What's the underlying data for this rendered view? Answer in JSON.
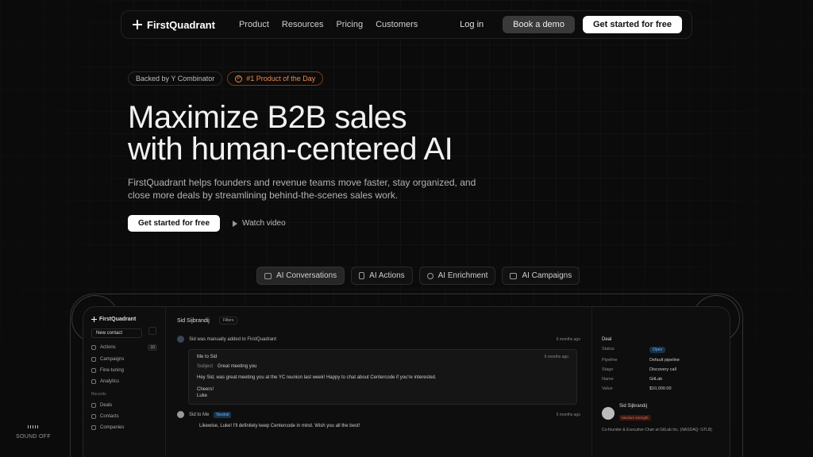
{
  "nav": {
    "brand": "FirstQuadrant",
    "links": [
      "Product",
      "Resources",
      "Pricing",
      "Customers"
    ],
    "login": "Log in",
    "demo": "Book a demo",
    "start": "Get started for free"
  },
  "hero": {
    "badge_yc": "Backed by Y Combinator",
    "badge_ph": "#1 Product of the Day",
    "headline_1": "Maximize B2B sales",
    "headline_2": "with human-centered AI",
    "subtext": "FirstQuadrant helps founders and revenue teams move faster, stay organized, and close more deals by streamlining behind-the-scenes sales work.",
    "cta_primary": "Get started for free",
    "cta_video": "Watch video"
  },
  "tabs": [
    {
      "label": "AI Conversations",
      "icon": "chat-icon",
      "active": true
    },
    {
      "label": "AI Actions",
      "icon": "document-icon",
      "active": false
    },
    {
      "label": "AI Enrichment",
      "icon": "search-icon",
      "active": false
    },
    {
      "label": "AI Campaigns",
      "icon": "mail-icon",
      "active": false
    }
  ],
  "app": {
    "brand": "FirstQuadrant",
    "new_contact": "New contact",
    "sidebar": [
      {
        "label": "Actions",
        "count": "10"
      },
      {
        "label": "Campaigns"
      },
      {
        "label": "Fine-tuning"
      },
      {
        "label": "Analytics"
      }
    ],
    "records_label": "Records",
    "records": [
      "Deals",
      "Contacts",
      "Companies"
    ],
    "contact_name": "Sid Sijbrandij",
    "filters": "Filters",
    "feed_event": "Sid was manually added to FirstQuadrant",
    "feed_event_time": "6 months ago",
    "email": {
      "from_to": "Me to Sid",
      "time": "6 months ago",
      "subject_label": "Subject",
      "subject": "Great meeting you",
      "body": "Hey Sid, was great meeting you at the YC reunion last week! Happy to chat about Centercode if you're interested.",
      "signoff_1": "Cheers!",
      "signoff_2": "Luke"
    },
    "reply": {
      "from_to": "Sid to Me",
      "tag": "Neutral",
      "time": "6 months ago",
      "body": "Likewise, Luke! I'll definitely keep Centercode in mind. Wish you all the best!"
    },
    "deal": {
      "title": "Deal",
      "rows": [
        {
          "k": "Status",
          "v": "Open"
        },
        {
          "k": "Pipeline",
          "v": "Default pipeline"
        },
        {
          "k": "Stage",
          "v": "Discovery call"
        },
        {
          "k": "Name",
          "v": "GitLab"
        },
        {
          "k": "Value",
          "v": "$10,000.00"
        }
      ],
      "person_name": "Sid Sijbrandij",
      "strength": "Medium strength",
      "role": "Co-founder & Executive Chair at GitLab Inc. (NASDAQ: GTLB)"
    }
  },
  "sound": "SOUND OFF"
}
